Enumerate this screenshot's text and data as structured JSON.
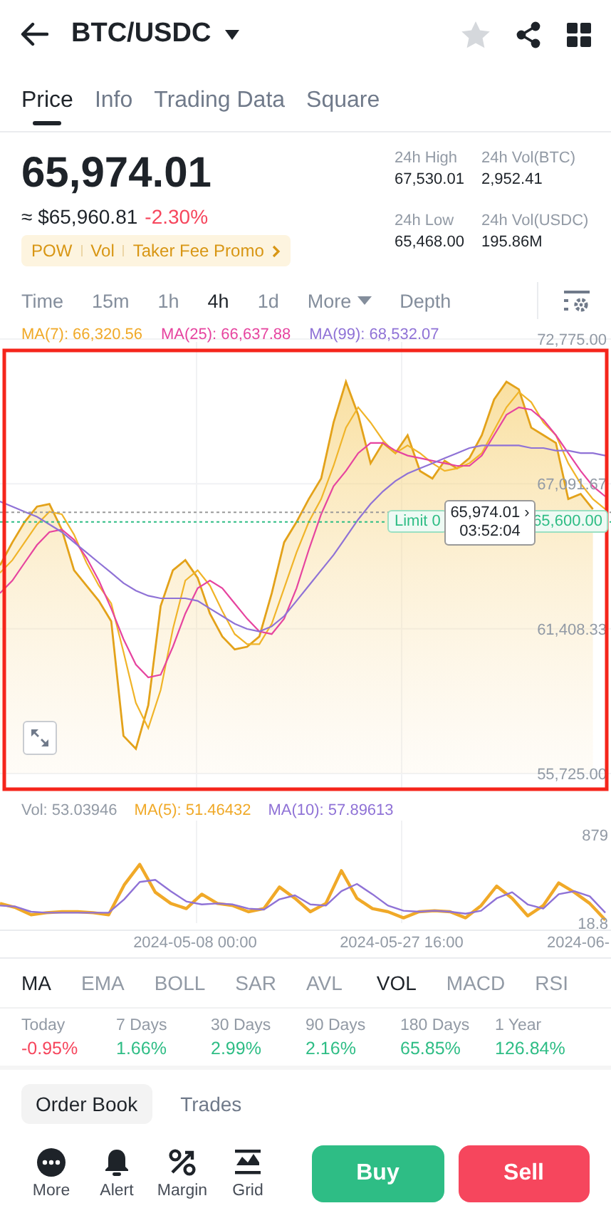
{
  "header": {
    "title": "BTC/USDC",
    "favorite": false
  },
  "tabs": [
    {
      "label": "Price",
      "selected": true
    },
    {
      "label": "Info",
      "selected": false
    },
    {
      "label": "Trading Data",
      "selected": false
    },
    {
      "label": "Square",
      "selected": false
    }
  ],
  "ticker": {
    "price": "65,974.01",
    "approx": "≈ $65,960.81",
    "change": "-2.30%",
    "tags": [
      "POW",
      "Vol",
      "Taker Fee Promo"
    ],
    "stats": [
      {
        "label": "24h High",
        "value": "67,530.01"
      },
      {
        "label": "24h Vol(BTC)",
        "value": "2,952.41"
      },
      {
        "label": "24h Low",
        "value": "65,468.00"
      },
      {
        "label": "24h Vol(USDC)",
        "value": "195.86M"
      }
    ]
  },
  "intervals": [
    {
      "label": "Time",
      "selected": false,
      "kind": "plain"
    },
    {
      "label": "15m",
      "selected": false,
      "kind": "plain"
    },
    {
      "label": "1h",
      "selected": false,
      "kind": "plain"
    },
    {
      "label": "4h",
      "selected": true,
      "kind": "plain"
    },
    {
      "label": "1d",
      "selected": false,
      "kind": "plain"
    },
    {
      "label": "More",
      "selected": false,
      "kind": "dropdown"
    },
    {
      "label": "Depth",
      "selected": false,
      "kind": "plain"
    }
  ],
  "price_chart": {
    "highlighted": true,
    "legend": [
      {
        "text": "MA(7): 66,320.56",
        "color": "#f0a928"
      },
      {
        "text": "MA(25): 66,637.88",
        "color": "#e6449f"
      },
      {
        "text": "MA(99): 68,532.07",
        "color": "#8f72d6"
      }
    ],
    "current_price": {
      "chevron": "›",
      "countdown": "03:52:04"
    },
    "limit_order": {
      "label": "Limit 0"
    },
    "chart_data": {
      "type": "line",
      "ylim": [
        55725,
        72775
      ],
      "grid": true,
      "ref_lines": [
        {
          "axis": "y",
          "value": 65974.01,
          "label": "65,974.01",
          "color": "#9a9a9a"
        },
        {
          "axis": "y",
          "value": 65600,
          "label": "65,600.00",
          "color": "#2ebd85"
        }
      ],
      "yticks": [
        {
          "value": 72775,
          "label": "72,775.00"
        },
        {
          "value": 67091.67,
          "label": "67,091.67"
        },
        {
          "value": 61408.33,
          "label": "61,408.33"
        },
        {
          "value": 55725,
          "label": "55,725.00"
        }
      ],
      "series": [
        {
          "type": "area",
          "color": "#e3a21a",
          "values": [
            63900,
            64800,
            65600,
            66200,
            66300,
            65300,
            63700,
            63100,
            62500,
            61700,
            57200,
            56700,
            58400,
            62300,
            63700,
            64100,
            63400,
            62000,
            61100,
            60600,
            60700,
            61100,
            62800,
            64800,
            65600,
            66500,
            67300,
            69500,
            71100,
            69800,
            67900,
            68700,
            68300,
            69000,
            67600,
            67300,
            68000,
            67700,
            68100,
            69000,
            70400,
            71100,
            70800,
            69300,
            69000,
            68700,
            66500,
            66700,
            66100,
            null
          ]
        },
        {
          "color": "#f0b429",
          "values": [
            63600,
            64100,
            64800,
            65500,
            66000,
            65900,
            65100,
            64000,
            63100,
            62400,
            60500,
            58500,
            57500,
            59000,
            61400,
            63300,
            63700,
            63100,
            62100,
            61200,
            60800,
            60800,
            61600,
            63000,
            64400,
            65600,
            66500,
            67800,
            69300,
            70100,
            69500,
            68800,
            68300,
            68600,
            68300,
            67900,
            67600,
            67700,
            67900,
            68300,
            69200,
            70100,
            70700,
            70300,
            69500,
            69000,
            67900,
            67100,
            66500,
            66100
          ]
        },
        {
          "color": "#e6449f",
          "values": [
            62800,
            63300,
            64000,
            64700,
            65200,
            65300,
            64900,
            64200,
            63300,
            62200,
            61000,
            60000,
            59500,
            59600,
            60700,
            62000,
            63000,
            63300,
            63000,
            62400,
            61800,
            61300,
            61200,
            61800,
            63000,
            64500,
            65900,
            67000,
            67600,
            68300,
            68700,
            68700,
            68400,
            68200,
            68100,
            68000,
            67900,
            67800,
            67800,
            68200,
            69000,
            69800,
            70100,
            70000,
            69600,
            69000,
            68300,
            67600,
            67000,
            66600
          ]
        },
        {
          "color": "#8f72d6",
          "values": [
            66400,
            66200,
            66000,
            65800,
            65500,
            65200,
            64800,
            64400,
            64000,
            63600,
            63200,
            62900,
            62700,
            62600,
            62600,
            62600,
            62500,
            62200,
            61900,
            61600,
            61400,
            61300,
            61500,
            61900,
            62500,
            63100,
            63700,
            64300,
            65000,
            65700,
            66300,
            66800,
            67200,
            67500,
            67700,
            67900,
            68100,
            68300,
            68500,
            68600,
            68600,
            68600,
            68600,
            68500,
            68500,
            68400,
            68400,
            68300,
            68300,
            68200
          ]
        }
      ]
    }
  },
  "volume_chart": {
    "legend": [
      {
        "text": "Vol: 53.03946",
        "color": "#929aa5"
      },
      {
        "text": "MA(5): 51.46432",
        "color": "#f0a928"
      },
      {
        "text": "MA(10): 57.89613",
        "color": "#8f72d6"
      }
    ],
    "chart_data": {
      "type": "line",
      "ylim": [
        18.8,
        879
      ],
      "yticks": [
        {
          "value": 879,
          "label": "879"
        },
        {
          "value": 18.8,
          "label": "18.8"
        }
      ],
      "series": [
        {
          "color": "#f0a928",
          "values": [
            210,
            170,
            100,
            120,
            130,
            130,
            120,
            100,
            390,
            590,
            320,
            210,
            160,
            300,
            210,
            190,
            130,
            160,
            370,
            260,
            130,
            210,
            530,
            260,
            160,
            130,
            70,
            130,
            140,
            130,
            70,
            190,
            380,
            260,
            90,
            190,
            410,
            320,
            210,
            50
          ]
        },
        {
          "color": "#8f72d6",
          "values": [
            190,
            180,
            130,
            120,
            120,
            120,
            120,
            120,
            250,
            420,
            440,
            330,
            230,
            200,
            210,
            200,
            160,
            150,
            250,
            290,
            200,
            190,
            330,
            400,
            300,
            190,
            140,
            130,
            140,
            130,
            110,
            140,
            260,
            320,
            200,
            160,
            300,
            330,
            280,
            120
          ]
        }
      ]
    },
    "x_labels": [
      "2024-05-08 00:00",
      "2024-05-27 16:00",
      "2024-06-"
    ]
  },
  "indicators": {
    "main": [
      {
        "label": "MA",
        "selected": true
      },
      {
        "label": "EMA",
        "selected": false
      },
      {
        "label": "BOLL",
        "selected": false
      },
      {
        "label": "SAR",
        "selected": false
      },
      {
        "label": "AVL",
        "selected": false
      }
    ],
    "sub": [
      {
        "label": "VOL",
        "selected": true
      },
      {
        "label": "MACD",
        "selected": false
      },
      {
        "label": "RSI",
        "selected": false
      }
    ]
  },
  "performance": [
    {
      "period": "Today",
      "value": "-0.95%",
      "color": "#f6465d"
    },
    {
      "period": "7 Days",
      "value": "1.66%",
      "color": "#2ebd85"
    },
    {
      "period": "30 Days",
      "value": "2.99%",
      "color": "#2ebd85"
    },
    {
      "period": "90 Days",
      "value": "2.16%",
      "color": "#2ebd85"
    },
    {
      "period": "180 Days",
      "value": "65.85%",
      "color": "#2ebd85"
    },
    {
      "period": "1 Year",
      "value": "126.84%",
      "color": "#2ebd85"
    }
  ],
  "book_tabs": [
    {
      "label": "Order Book",
      "selected": true
    },
    {
      "label": "Trades",
      "selected": false
    }
  ],
  "actions": [
    {
      "label": "More",
      "kind": "more"
    },
    {
      "label": "Alert",
      "kind": "bell"
    },
    {
      "label": "Margin",
      "kind": "percent"
    },
    {
      "label": "Grid",
      "kind": "grid"
    }
  ],
  "trade_buttons": [
    {
      "label": "Buy",
      "kind": "buy"
    },
    {
      "label": "Sell",
      "kind": "sell"
    }
  ]
}
